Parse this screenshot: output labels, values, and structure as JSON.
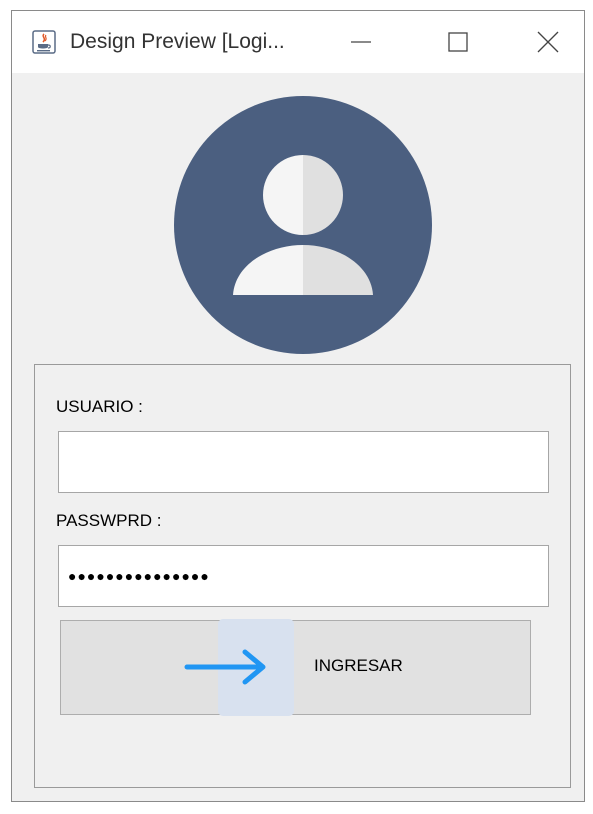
{
  "window": {
    "title": "Design Preview [Logi...",
    "app_icon": "java-icon",
    "controls": [
      "minimize-icon",
      "maximize-icon",
      "close-icon"
    ]
  },
  "avatar": {
    "icon": "user-icon",
    "background_color": "#4b5f80",
    "figure_color": "#f5f5f5",
    "figure_shade_color": "#e0e0e0"
  },
  "form": {
    "username_label": "USUARIO :",
    "username_value": "",
    "password_label": "PASSWPRD :",
    "password_masked": "●●●●●●●●●●●●●●●",
    "submit_label": "INGRESAR",
    "submit_icon": "arrow-right-icon",
    "accent_color": "#2196f3"
  }
}
